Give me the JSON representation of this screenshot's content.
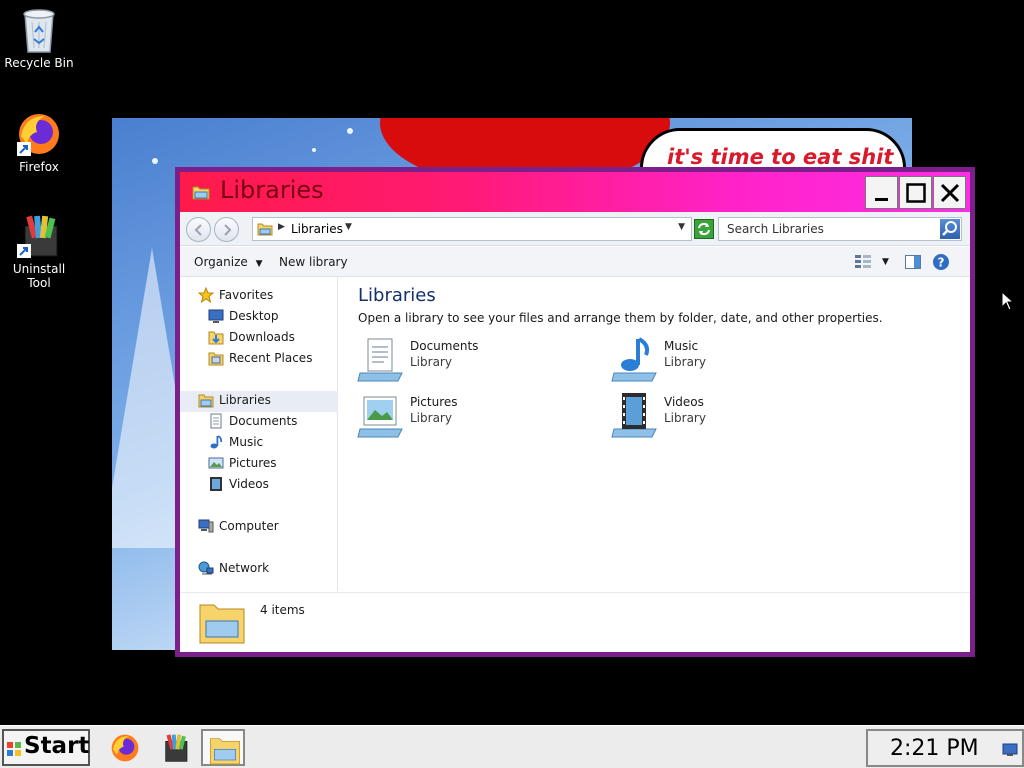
{
  "desktop": {
    "icons": [
      {
        "label": "Recycle Bin"
      },
      {
        "label": "Firefox"
      },
      {
        "label": "Uninstall Tool"
      }
    ],
    "wallpaper_caption": "it's time to eat shit"
  },
  "window": {
    "title": "Libraries",
    "address": {
      "crumb": "Libraries"
    },
    "search_placeholder": "Search Libraries",
    "commands": {
      "organize": "Organize",
      "new_library": "New library"
    },
    "nav": {
      "favorites": "Favorites",
      "desktop": "Desktop",
      "downloads": "Downloads",
      "recent_places": "Recent Places",
      "libraries": "Libraries",
      "documents": "Documents",
      "music": "Music",
      "pictures": "Pictures",
      "videos": "Videos",
      "computer": "Computer",
      "network": "Network"
    },
    "content": {
      "heading": "Libraries",
      "description": "Open a library to see your files and arrange them by folder, date, and other properties.",
      "libraries": [
        {
          "name": "Documents",
          "type": "Library",
          "icon": "documents-icon"
        },
        {
          "name": "Music",
          "type": "Library",
          "icon": "music-icon"
        },
        {
          "name": "Pictures",
          "type": "Library",
          "icon": "pictures-icon"
        },
        {
          "name": "Videos",
          "type": "Library",
          "icon": "videos-icon"
        }
      ]
    },
    "details": {
      "item_count": "4 items"
    }
  },
  "taskbar": {
    "start_label": "Start",
    "clock": "2:21 PM"
  },
  "colors": {
    "title_gradient_start": "#ff1a4a",
    "title_gradient_end": "#ff2ee6",
    "window_border": "#7b1f8a",
    "heading": "#13306b"
  }
}
